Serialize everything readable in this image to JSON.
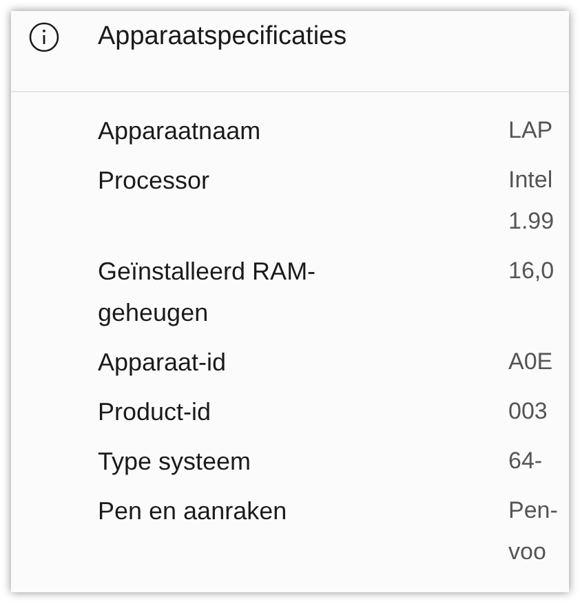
{
  "section": {
    "title": "Apparaatspecificaties"
  },
  "specs": [
    {
      "label": "Apparaatnaam",
      "value": [
        "LAP"
      ]
    },
    {
      "label": "Processor",
      "value": [
        "Intel",
        "1.99"
      ]
    },
    {
      "label": "Geïnstalleerd RAM-geheugen",
      "value": [
        "16,0"
      ]
    },
    {
      "label": "Apparaat-id",
      "value": [
        "A0E"
      ]
    },
    {
      "label": "Product-id",
      "value": [
        "003"
      ]
    },
    {
      "label": "Type systeem",
      "value": [
        "64-"
      ]
    },
    {
      "label": "Pen en aanraken",
      "value": [
        "Pen-",
        "voo"
      ]
    }
  ]
}
